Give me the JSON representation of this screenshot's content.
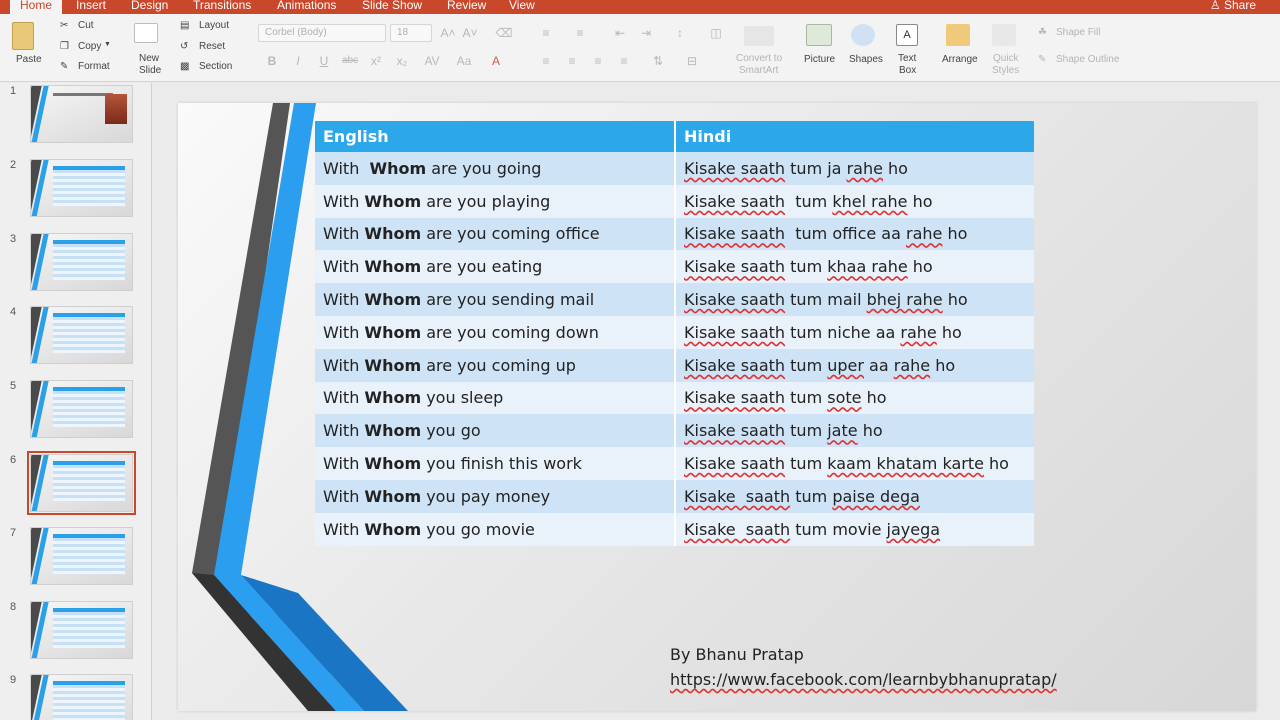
{
  "tabs": [
    "Home",
    "Insert",
    "Design",
    "Transitions",
    "Animations",
    "Slide Show",
    "Review",
    "View"
  ],
  "share_label": "Share",
  "ribbon": {
    "paste": "Paste",
    "cut": "Cut",
    "copy": "Copy",
    "format": "Format",
    "new_slide": [
      "New",
      "Slide"
    ],
    "layout": "Layout",
    "reset": "Reset",
    "section": "Section",
    "font_name": "Corbel (Body)",
    "font_size": "18",
    "convert": [
      "Convert to",
      "SmartArt"
    ],
    "picture": "Picture",
    "shapes": "Shapes",
    "text_box": [
      "Text",
      "Box"
    ],
    "arrange": "Arrange",
    "quick_styles": [
      "Quick",
      "Styles"
    ],
    "shape_fill": "Shape Fill",
    "shape_outline": "Shape Outline"
  },
  "thumbnails": {
    "numbers": [
      "1",
      "2",
      "3",
      "4",
      "5",
      "6",
      "7",
      "8",
      "9"
    ],
    "selected": "6"
  },
  "slide": {
    "headers": [
      "English",
      "Hindi"
    ],
    "rows": [
      {
        "pre": "With  ",
        "bold": "Whom",
        "post": " are you going",
        "hindi": [
          [
            "Kisake saath",
            true
          ],
          [
            " tum ja ",
            false
          ],
          [
            "rahe",
            true
          ],
          [
            " ho",
            false
          ]
        ]
      },
      {
        "pre": "With ",
        "bold": "Whom",
        "post": " are you playing",
        "hindi": [
          [
            "Kisake saath",
            true
          ],
          [
            "  tum ",
            false
          ],
          [
            "khel rahe",
            true
          ],
          [
            " ho",
            false
          ]
        ]
      },
      {
        "pre": "With ",
        "bold": "Whom",
        "post": " are you coming office",
        "hindi": [
          [
            "Kisake saath",
            true
          ],
          [
            "  tum office aa ",
            false
          ],
          [
            "rahe",
            true
          ],
          [
            " ho",
            false
          ]
        ]
      },
      {
        "pre": "With ",
        "bold": "Whom",
        "post": " are you eating",
        "hindi": [
          [
            "Kisake saath",
            true
          ],
          [
            " tum ",
            false
          ],
          [
            "khaa rahe",
            true
          ],
          [
            " ho",
            false
          ]
        ]
      },
      {
        "pre": "With ",
        "bold": "Whom",
        "post": " are you sending mail",
        "hindi": [
          [
            "Kisake saath",
            true
          ],
          [
            " tum mail ",
            false
          ],
          [
            "bhej rahe",
            true
          ],
          [
            " ho",
            false
          ]
        ]
      },
      {
        "pre": "With ",
        "bold": "Whom",
        "post": " are you coming down",
        "hindi": [
          [
            "Kisake saath",
            true
          ],
          [
            " tum niche aa ",
            false
          ],
          [
            "rahe",
            true
          ],
          [
            " ho",
            false
          ]
        ]
      },
      {
        "pre": "With ",
        "bold": "Whom",
        "post": " are you coming up",
        "hindi": [
          [
            "Kisake saath",
            true
          ],
          [
            " tum ",
            false
          ],
          [
            "uper",
            true
          ],
          [
            " aa ",
            false
          ],
          [
            "rahe",
            true
          ],
          [
            " ho",
            false
          ]
        ]
      },
      {
        "pre": "With ",
        "bold": "Whom",
        "post": " you sleep",
        "hindi": [
          [
            "Kisake saath",
            true
          ],
          [
            " tum ",
            false
          ],
          [
            "sote",
            true
          ],
          [
            " ho",
            false
          ]
        ]
      },
      {
        "pre": "With ",
        "bold": "Whom",
        "post": " you go",
        "hindi": [
          [
            "Kisake saath",
            true
          ],
          [
            " tum ",
            false
          ],
          [
            "jate",
            true
          ],
          [
            " ho",
            false
          ]
        ]
      },
      {
        "pre": "With ",
        "bold": "Whom",
        "post": " you finish this work",
        "hindi": [
          [
            "Kisake saath",
            true
          ],
          [
            " tum ",
            false
          ],
          [
            "kaam khatam karte",
            true
          ],
          [
            " ho",
            false
          ]
        ]
      },
      {
        "pre": "With ",
        "bold": "Whom",
        "post": " you pay money",
        "hindi": [
          [
            "Kisake  saath",
            true
          ],
          [
            " tum ",
            false
          ],
          [
            "paise dega",
            true
          ]
        ]
      },
      {
        "pre": "With ",
        "bold": "Whom",
        "post": " you go movie",
        "hindi": [
          [
            "Kisake  saath",
            true
          ],
          [
            " tum movie ",
            false
          ],
          [
            "jayega",
            true
          ]
        ]
      }
    ],
    "author": "By Bhanu Pratap",
    "url": "https://www.facebook.com/learnbybhanupratap/"
  },
  "colors": {
    "accent": "#c9472b",
    "table_header": "#2ca7ea",
    "row_odd": "#cfe3f7",
    "row_even": "#e9f1fb"
  }
}
